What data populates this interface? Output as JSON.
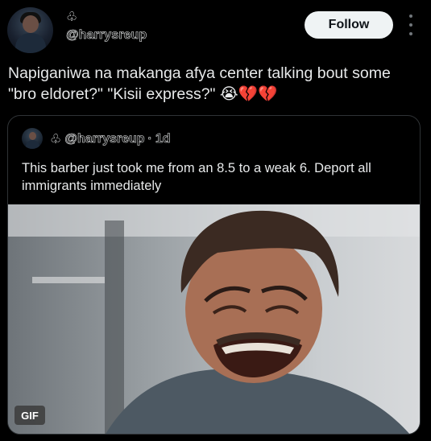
{
  "header": {
    "author_emoji": "♧",
    "author_handle": "@harrysreup",
    "follow_label": "Follow",
    "more_icon": "more-vertical-icon"
  },
  "post": {
    "text": "Napiganiwa na makanga afya center talking bout some \"bro eldoret?\" \"Kisii express?\" 😭💔💔"
  },
  "quoted": {
    "emoji": "♧",
    "handle": "@harrysreup",
    "separator": "·",
    "age": "1d",
    "text": "This barber just took me from an 8.5 to a weak 6. Deport all immigrants immediately",
    "media_badge": "GIF"
  },
  "colors": {
    "background": "#000000",
    "text": "#e7e9ea",
    "follow_bg": "#eff3f4",
    "border": "#2f3336"
  }
}
